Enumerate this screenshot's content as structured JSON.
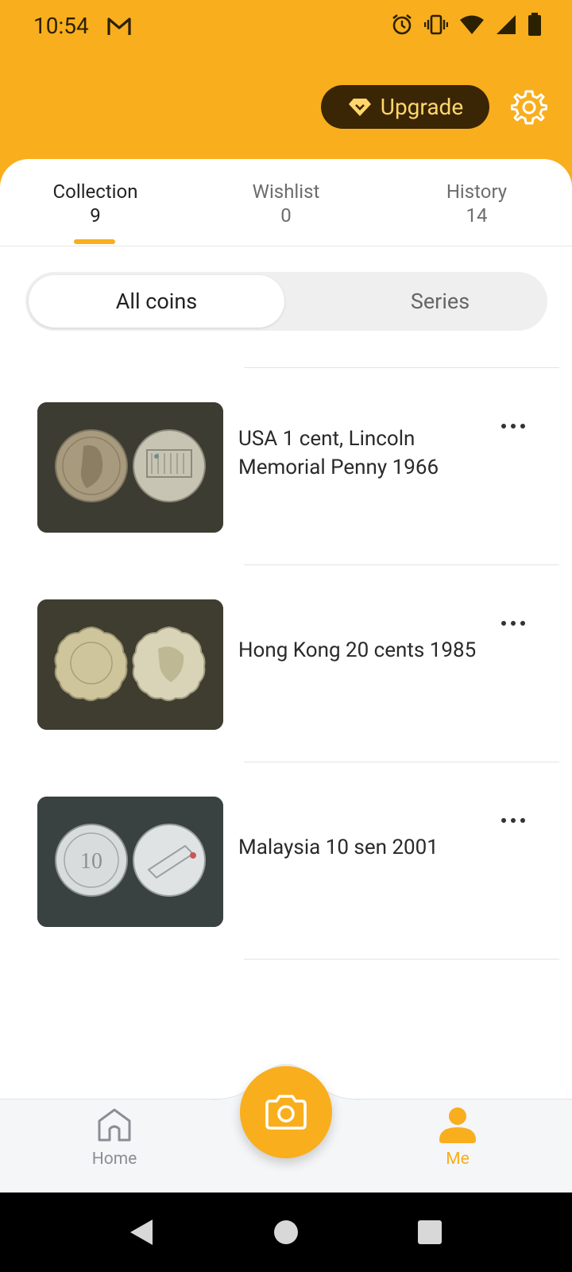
{
  "status_bar": {
    "time": "10:54",
    "icons": [
      "gmail-icon",
      "alarm-icon",
      "vibrate-icon",
      "wifi-icon",
      "signal-icon",
      "battery-icon"
    ]
  },
  "header": {
    "upgrade_label": "Upgrade",
    "accent_color": "#F9AE1E",
    "upgrade_bg": "#3A2605"
  },
  "tabs": [
    {
      "label": "Collection",
      "count": "9",
      "active": true
    },
    {
      "label": "Wishlist",
      "count": "0",
      "active": false
    },
    {
      "label": "History",
      "count": "14",
      "active": false
    }
  ],
  "segment": {
    "options": [
      "All coins",
      "Series"
    ],
    "selected": "All coins"
  },
  "coins": [
    {
      "title": "USA 1 cent, Lincoln Memorial Penny 1966",
      "thumb_bg": "#3d3c33"
    },
    {
      "title": "Hong Kong 20 cents 1985",
      "thumb_bg": "#3f3d30"
    },
    {
      "title": "Malaysia 10 sen 2001",
      "thumb_bg": "#394141"
    }
  ],
  "bottom_nav": {
    "items": [
      {
        "label": "Home",
        "icon": "home-icon",
        "active": false
      },
      {
        "label": "Me",
        "icon": "person-icon",
        "active": true
      }
    ],
    "center_icon": "camera-icon"
  },
  "system_nav": [
    "back-icon",
    "home-circle-icon",
    "recents-icon"
  ]
}
